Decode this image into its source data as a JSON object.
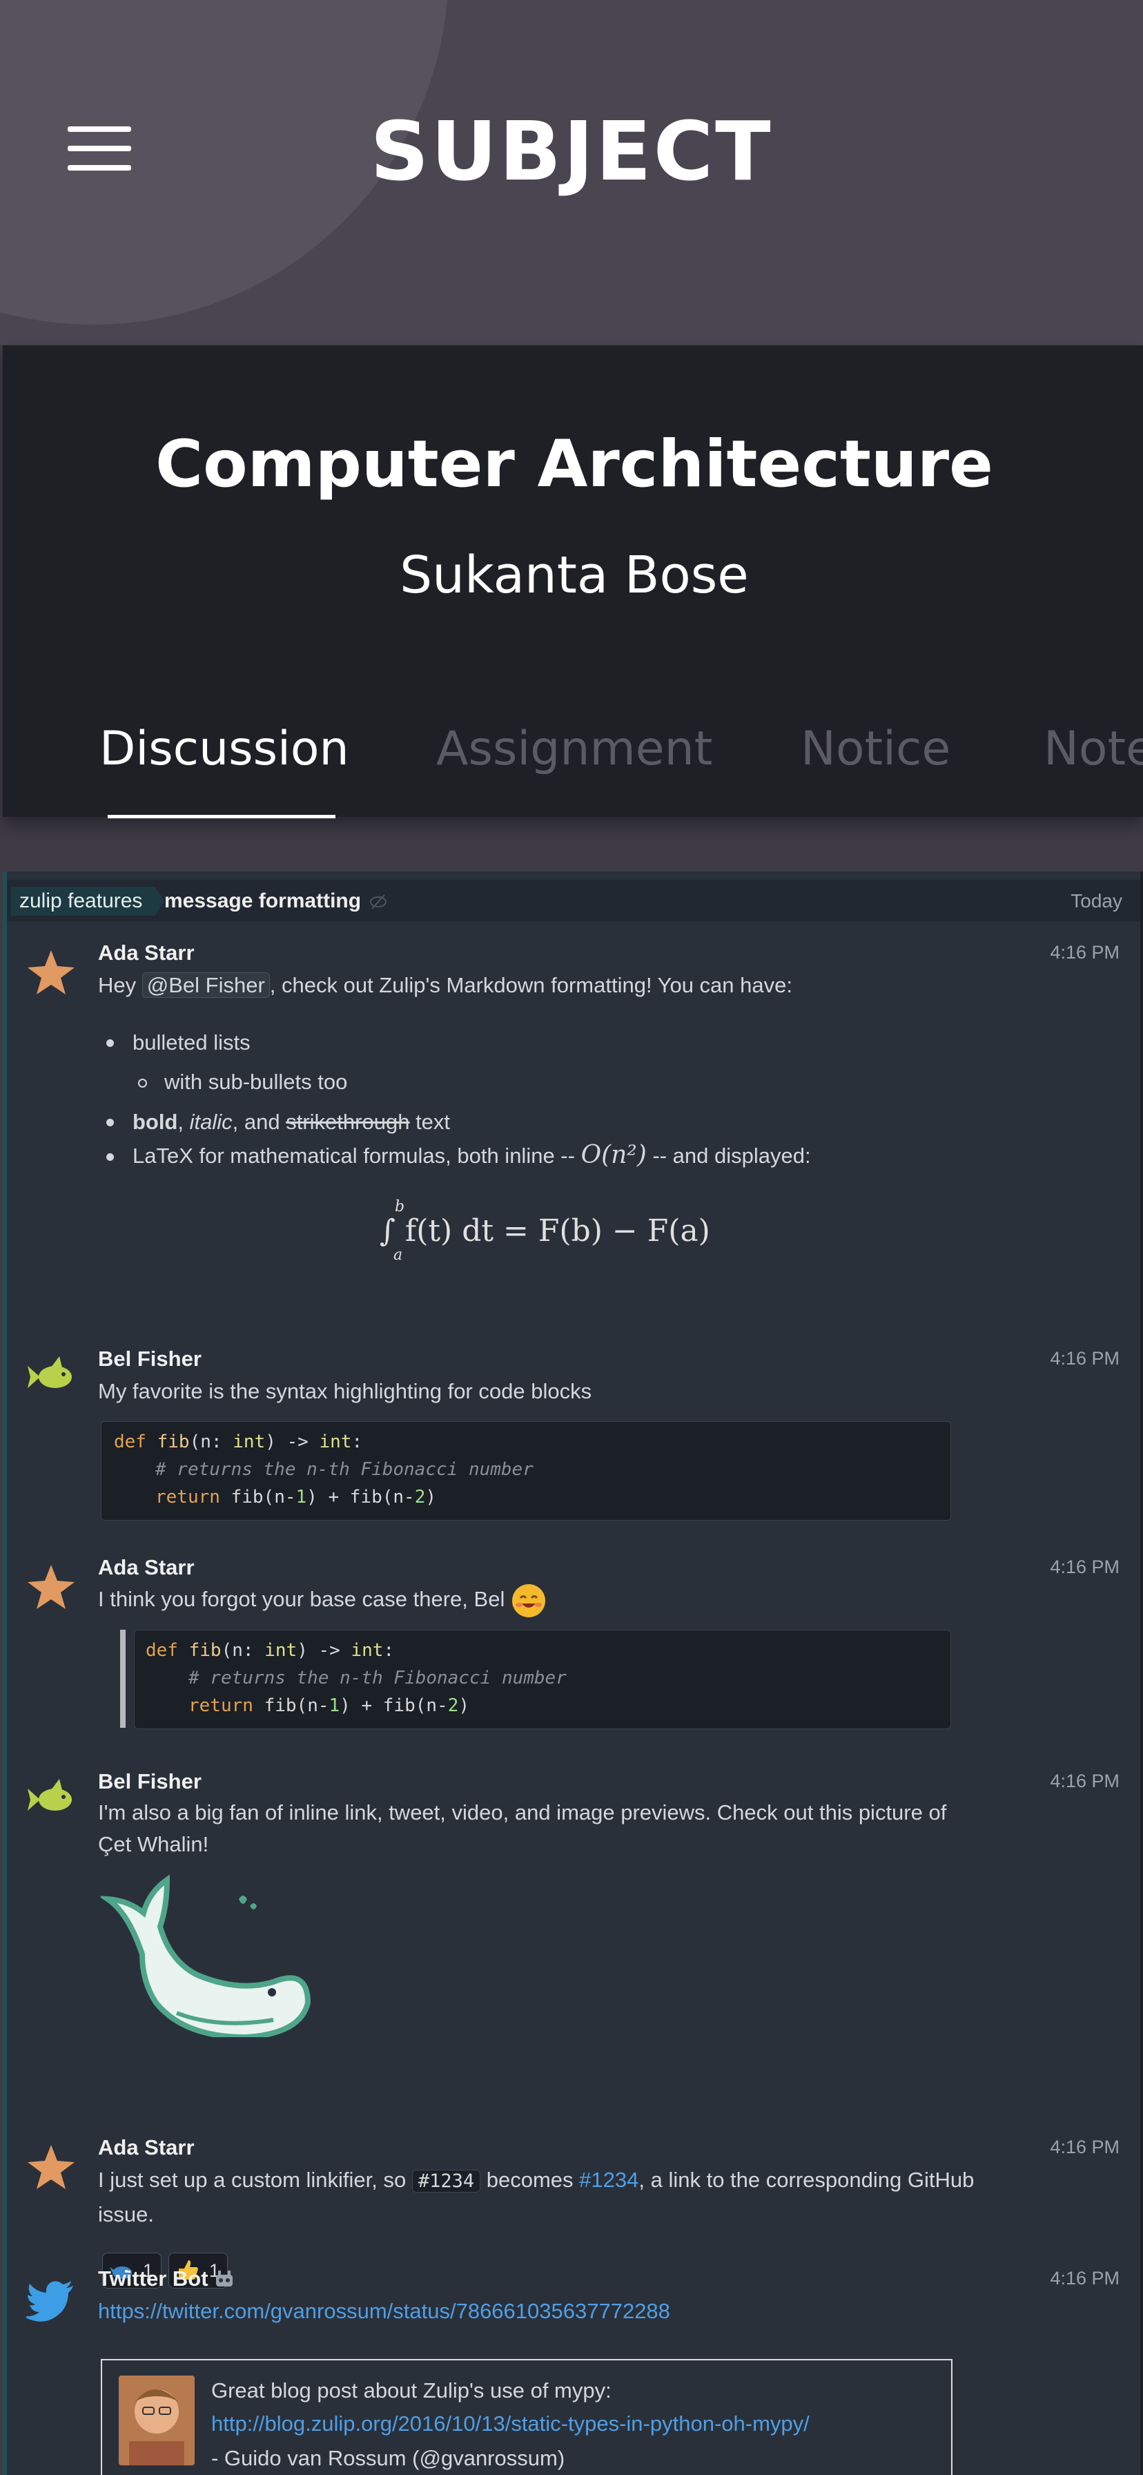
{
  "header": {
    "title": "SUBJECT",
    "menu_icon": "hamburger-menu-icon"
  },
  "course": {
    "title": "Computer Architecture",
    "teacher": "Sukanta Bose",
    "tabs": [
      {
        "label": "Discussion",
        "active": true
      },
      {
        "label": "Assignment",
        "active": false
      },
      {
        "label": "Notice",
        "active": false
      },
      {
        "label": "Note",
        "active": false
      }
    ]
  },
  "recipient_bar": {
    "stream": "zulip features",
    "topic": "message formatting",
    "date": "Today"
  },
  "messages": [
    {
      "sender": "Ada Starr",
      "time": "4:16 PM",
      "avatar_icon": "starfish-icon",
      "intro_before": "Hey ",
      "mention": "@Bel Fisher",
      "intro_after": ", check out Zulip's Markdown formatting! You can have:",
      "bullets": [
        {
          "text": "bulleted lists"
        },
        {
          "text": "with sub-bullets too"
        },
        {
          "bold": "bold",
          "sep1": ", ",
          "italic": "italic",
          "sep2": ", and ",
          "strike": "strikethrough",
          "end": " text"
        },
        {
          "text_before": "LaTeX for mathematical formulas, both inline -- ",
          "math": "O(n²)",
          "text_after": " -- and displayed:"
        }
      ],
      "display_math": "∫ f(t) dt = F(b) − F(a)",
      "math_lower": "a",
      "math_upper": "b"
    },
    {
      "sender": "Bel Fisher",
      "time": "4:16 PM",
      "avatar_icon": "fish-icon",
      "text": "My favorite is the syntax highlighting for code blocks",
      "code": {
        "l1_kw": "def",
        "l1_fn": "fib",
        "l1_p1": "(n: ",
        "l1_ty": "int",
        "l1_p2": ") -> ",
        "l1_ty2": "int",
        "l1_p3": ":",
        "l2_cm": "# returns the n-th Fibonacci number",
        "l3_kw": "return",
        "l3_a": " fib(n-",
        "l3_n1": "1",
        "l3_b": ") + fib(n-",
        "l3_n2": "2",
        "l3_c": ")"
      }
    },
    {
      "sender": "Ada Starr",
      "time": "4:16 PM",
      "avatar_icon": "starfish-icon",
      "text": "I think you forgot your base case there, Bel",
      "emoji": "smiling-face-emoji"
    },
    {
      "sender": "Bel Fisher",
      "time": "4:16 PM",
      "avatar_icon": "fish-icon",
      "text_l1": "I'm also a big fan of inline link, tweet, video, and image previews. Check out this picture of",
      "text_l2": "Çet Whalin!",
      "image": "whale-illustration",
      "reactions": [
        {
          "emoji": "whale-emoji",
          "count": "1"
        },
        {
          "emoji": "thumbs-up-emoji",
          "count": "1"
        }
      ]
    },
    {
      "sender": "Ada Starr",
      "time": "4:16 PM",
      "avatar_icon": "starfish-icon",
      "text_before": "I just set up a custom linkifier, so ",
      "code": "#1234",
      "text_mid": " becomes ",
      "link": "#1234",
      "text_after": ", a link to the corresponding GitHub",
      "text_l2": "issue."
    },
    {
      "sender": "Twitter Bot",
      "time": "4:16 PM",
      "avatar_icon": "twitter-bird-icon",
      "bot_icon": "bot-icon",
      "link": "https://twitter.com/gvanrossum/status/786661035637772288",
      "tweet": {
        "text": "Great blog post about Zulip's use of mypy:",
        "link": "http://blog.zulip.org/2016/10/13/static-types-in-python-oh-mypy/",
        "author": "- Guido van Rossum (@gvanrossum)"
      }
    }
  ],
  "colors": {
    "header_bg": "#4a4651",
    "course_bg": "#1f1f26",
    "feed_bg": "#2a303a",
    "link": "#4f9fe6",
    "stream_tag": "#1d3a42"
  }
}
